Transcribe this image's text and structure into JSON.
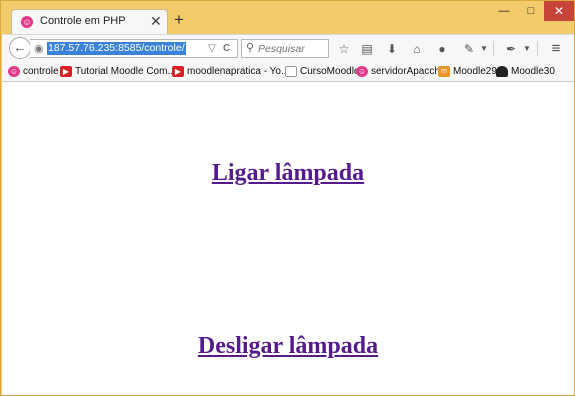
{
  "tab": {
    "title": "Controle em PHP",
    "close": "✕",
    "icon": "☺"
  },
  "new_tab": "+",
  "window_controls": {
    "minimize": "—",
    "maximize": "□",
    "close": "✕"
  },
  "navbar": {
    "back": "←",
    "url": "187.57.76.235:8585/controle/",
    "dropdown": "▽",
    "reload": "C",
    "search_placeholder": "Pesquisar",
    "icons": [
      "bookmark-star-icon",
      "reading-list-icon",
      "download-icon",
      "home-icon",
      "chat-icon",
      "extension-icon",
      "dropdown-icon",
      "pen-icon",
      "dropdown-icon",
      "menu-icon"
    ]
  },
  "bookmarks": [
    {
      "label": "controle",
      "icon": "smiley-icon",
      "color": "#e23a8a"
    },
    {
      "label": "Tutorial Moodle Com...",
      "icon": "youtube-icon",
      "color": "#d62222"
    },
    {
      "label": "moodlenapratica - Yo...",
      "icon": "youtube-icon",
      "color": "#d62222"
    },
    {
      "label": "CursoMoodle",
      "icon": "page-icon",
      "color": "#ffffff"
    },
    {
      "label": "servidorApacche",
      "icon": "smiley-icon",
      "color": "#e23a8a"
    },
    {
      "label": "Moodle29",
      "icon": "moodle-icon",
      "color": "#e8942a"
    },
    {
      "label": "Moodle30",
      "icon": "person-icon",
      "color": "#222222"
    }
  ],
  "main": {
    "link_on": "Ligar lâmpada",
    "link_off": "Desligar lâmpada"
  },
  "colors": {
    "frame": "#f2cb6a",
    "link": "#551a8b",
    "url_highlight": "#3b83d6"
  }
}
